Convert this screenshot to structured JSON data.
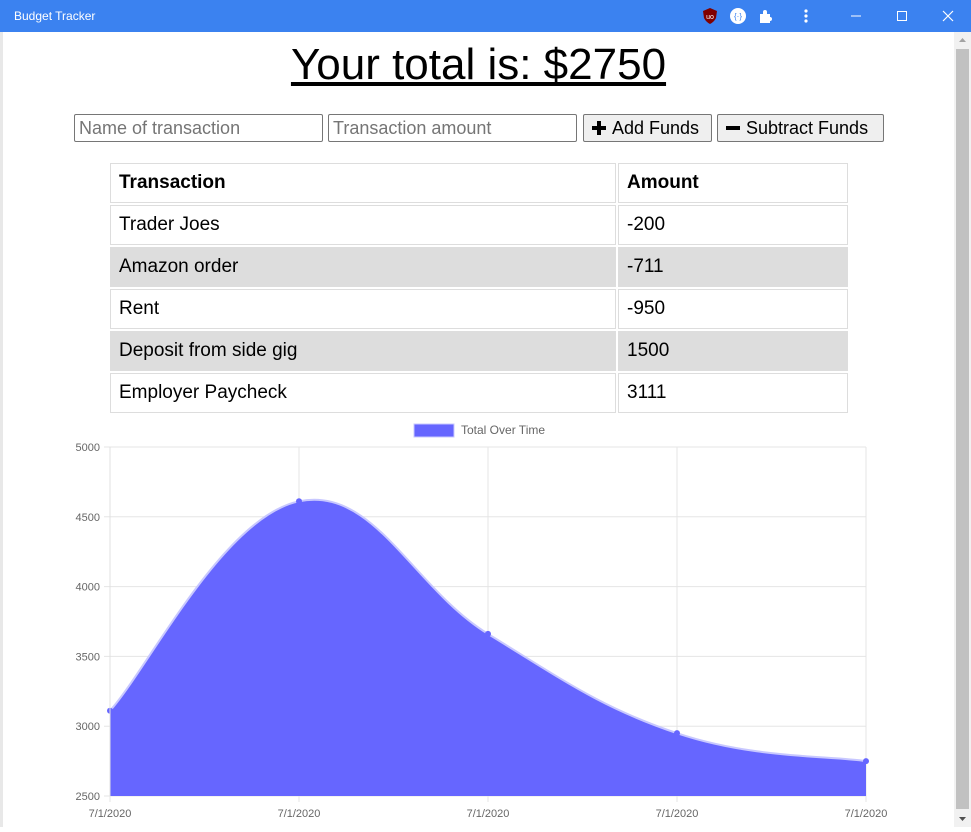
{
  "window": {
    "title": "Budget Tracker",
    "extensions": [
      "ublock-icon",
      "devtools-extension-icon",
      "puzzle-icon"
    ],
    "accent": "#3b82f0"
  },
  "header": {
    "total_text": "Your total is: $2750"
  },
  "form": {
    "name_placeholder": "Name of transaction",
    "amount_placeholder": "Transaction amount",
    "add_label": "Add Funds",
    "subtract_label": "Subtract Funds"
  },
  "table": {
    "headers": [
      "Transaction",
      "Amount"
    ],
    "rows": [
      {
        "name": "Trader Joes",
        "amount": "-200"
      },
      {
        "name": "Amazon order",
        "amount": "-711"
      },
      {
        "name": "Rent",
        "amount": "-950"
      },
      {
        "name": "Deposit from side gig",
        "amount": "1500"
      },
      {
        "name": "Employer Paycheck",
        "amount": "3111"
      }
    ]
  },
  "chart_data": {
    "type": "area",
    "categories": [
      "7/1/2020",
      "7/1/2020",
      "7/1/2020",
      "7/1/2020",
      "7/1/2020"
    ],
    "series": [
      {
        "name": "Total Over Time",
        "values": [
          3111,
          4611,
          3661,
          2950,
          2750
        ],
        "color": "#6666ff"
      }
    ],
    "ylim": [
      2500,
      5000
    ],
    "yticks": [
      2500,
      3000,
      3500,
      4000,
      4500,
      5000
    ],
    "grid": true,
    "legend": "top"
  }
}
